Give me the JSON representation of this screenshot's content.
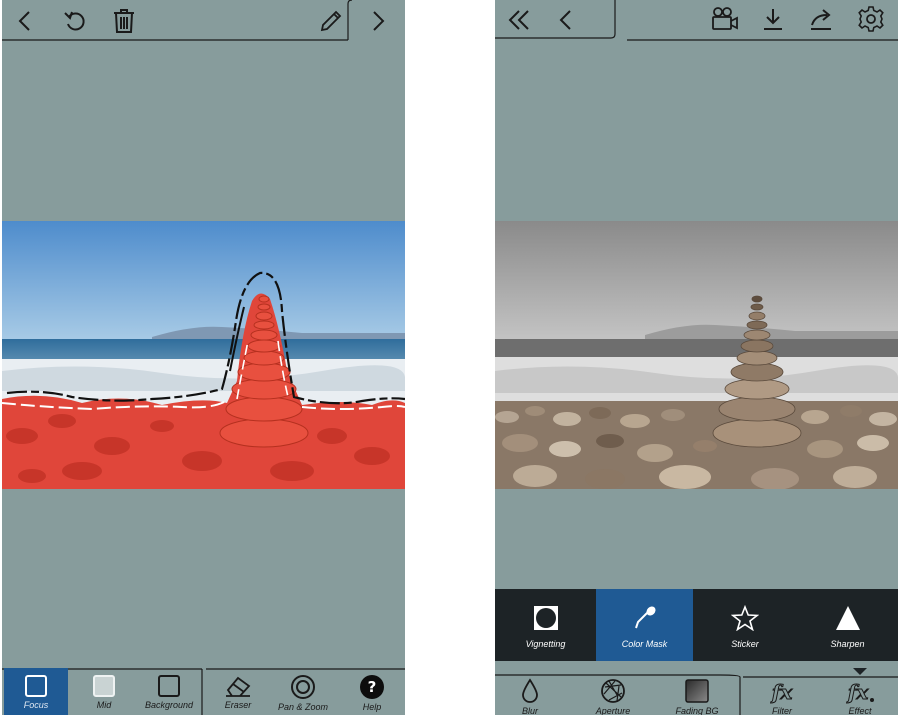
{
  "left_panel": {
    "topbar": {
      "back_icon": "chevron-left-icon",
      "undo_icon": "undo-icon",
      "delete_icon": "trash-icon",
      "edit_icon": "pencil-icon",
      "forward_icon": "chevron-right-icon"
    },
    "tools": [
      {
        "label": "Focus",
        "icon": "square-icon",
        "active": true
      },
      {
        "label": "Mid",
        "icon": "light-square-icon",
        "active": false
      },
      {
        "label": "Background",
        "icon": "square-icon",
        "active": false
      },
      {
        "label": "Eraser",
        "icon": "eraser-icon",
        "active": false
      },
      {
        "label": "Pan & Zoom",
        "icon": "target-icon",
        "active": false
      },
      {
        "label": "Help",
        "icon": "help-icon",
        "active": false
      }
    ]
  },
  "right_panel": {
    "topbar": {
      "double_back_icon": "double-chevron-left-icon",
      "back_icon": "chevron-left-icon",
      "video_icon": "video-camera-icon",
      "download_icon": "download-icon",
      "share_icon": "share-icon",
      "settings_icon": "gear-icon"
    },
    "effects": [
      {
        "label": "Vignetting",
        "icon": "vignette-icon",
        "active": false
      },
      {
        "label": "Color Mask",
        "icon": "pipette-icon",
        "active": true
      },
      {
        "label": "Sticker",
        "icon": "star-icon",
        "active": false
      },
      {
        "label": "Sharpen",
        "icon": "triangle-icon",
        "active": false
      }
    ],
    "tools": [
      {
        "label": "Blur",
        "icon": "droplet-icon"
      },
      {
        "label": "Aperture",
        "icon": "aperture-icon"
      },
      {
        "label": "Fading BG",
        "icon": "gradient-square-icon"
      },
      {
        "label": "Filter",
        "icon": "fx-icon"
      },
      {
        "label": "Effect",
        "icon": "fx-icon"
      }
    ]
  },
  "colors": {
    "panel_bg": "#879c9c",
    "accent": "#1f5a94",
    "mask_red": "#e0463a",
    "effect_strip_bg": "#1d2326"
  }
}
